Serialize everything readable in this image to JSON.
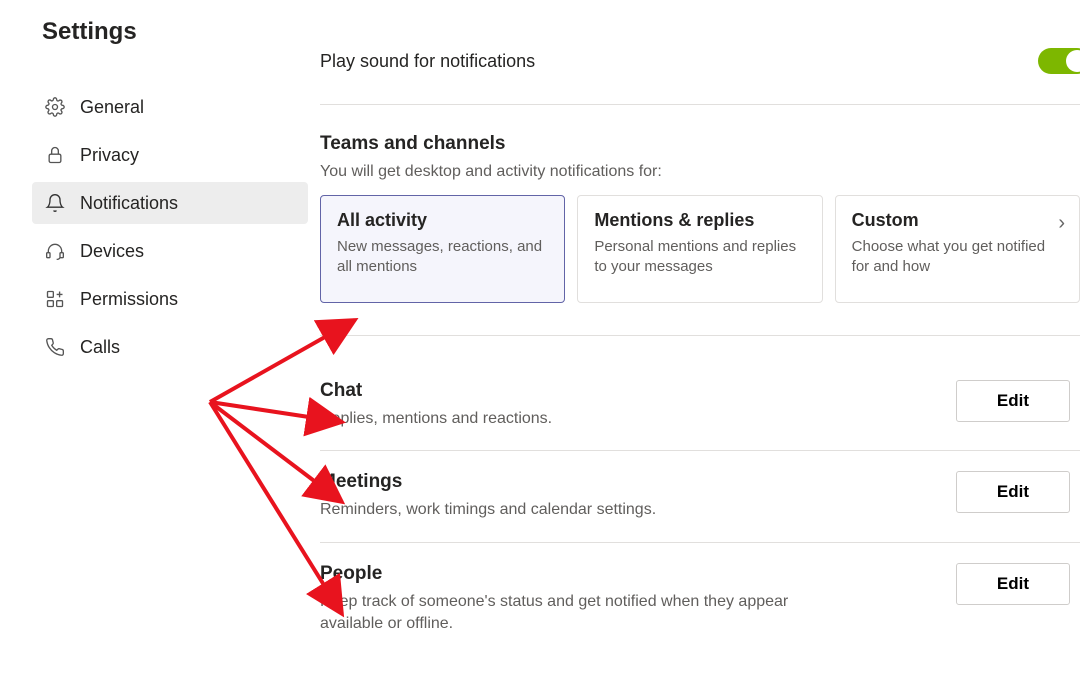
{
  "sidebar": {
    "title": "Settings",
    "items": [
      {
        "key": "general",
        "label": "General"
      },
      {
        "key": "privacy",
        "label": "Privacy"
      },
      {
        "key": "notifications",
        "label": "Notifications",
        "active": true
      },
      {
        "key": "devices",
        "label": "Devices"
      },
      {
        "key": "permissions",
        "label": "Permissions"
      },
      {
        "key": "calls",
        "label": "Calls"
      }
    ]
  },
  "main": {
    "play_sound_label": "Play sound for notifications",
    "play_sound_on": true,
    "teams_channels": {
      "header": "Teams and channels",
      "sub": "You will get desktop and activity notifications for:",
      "options": [
        {
          "key": "all",
          "title": "All activity",
          "desc": "New messages, reactions, and all mentions",
          "selected": true
        },
        {
          "key": "mentions",
          "title": "Mentions & replies",
          "desc": "Personal mentions and replies to your messages"
        },
        {
          "key": "custom",
          "title": "Custom",
          "desc": "Choose what you get notified for and how",
          "chevron": true
        }
      ]
    },
    "sections": [
      {
        "key": "chat",
        "title": "Chat",
        "desc": "Replies, mentions and reactions.",
        "button": "Edit"
      },
      {
        "key": "meetings",
        "title": "Meetings",
        "desc": "Reminders, work timings and calendar settings.",
        "button": "Edit"
      },
      {
        "key": "people",
        "title": "People",
        "desc": "Keep track of someone's status and get notified when they appear available or offline.",
        "button": "Edit"
      }
    ]
  },
  "accent_color": "#7db700"
}
